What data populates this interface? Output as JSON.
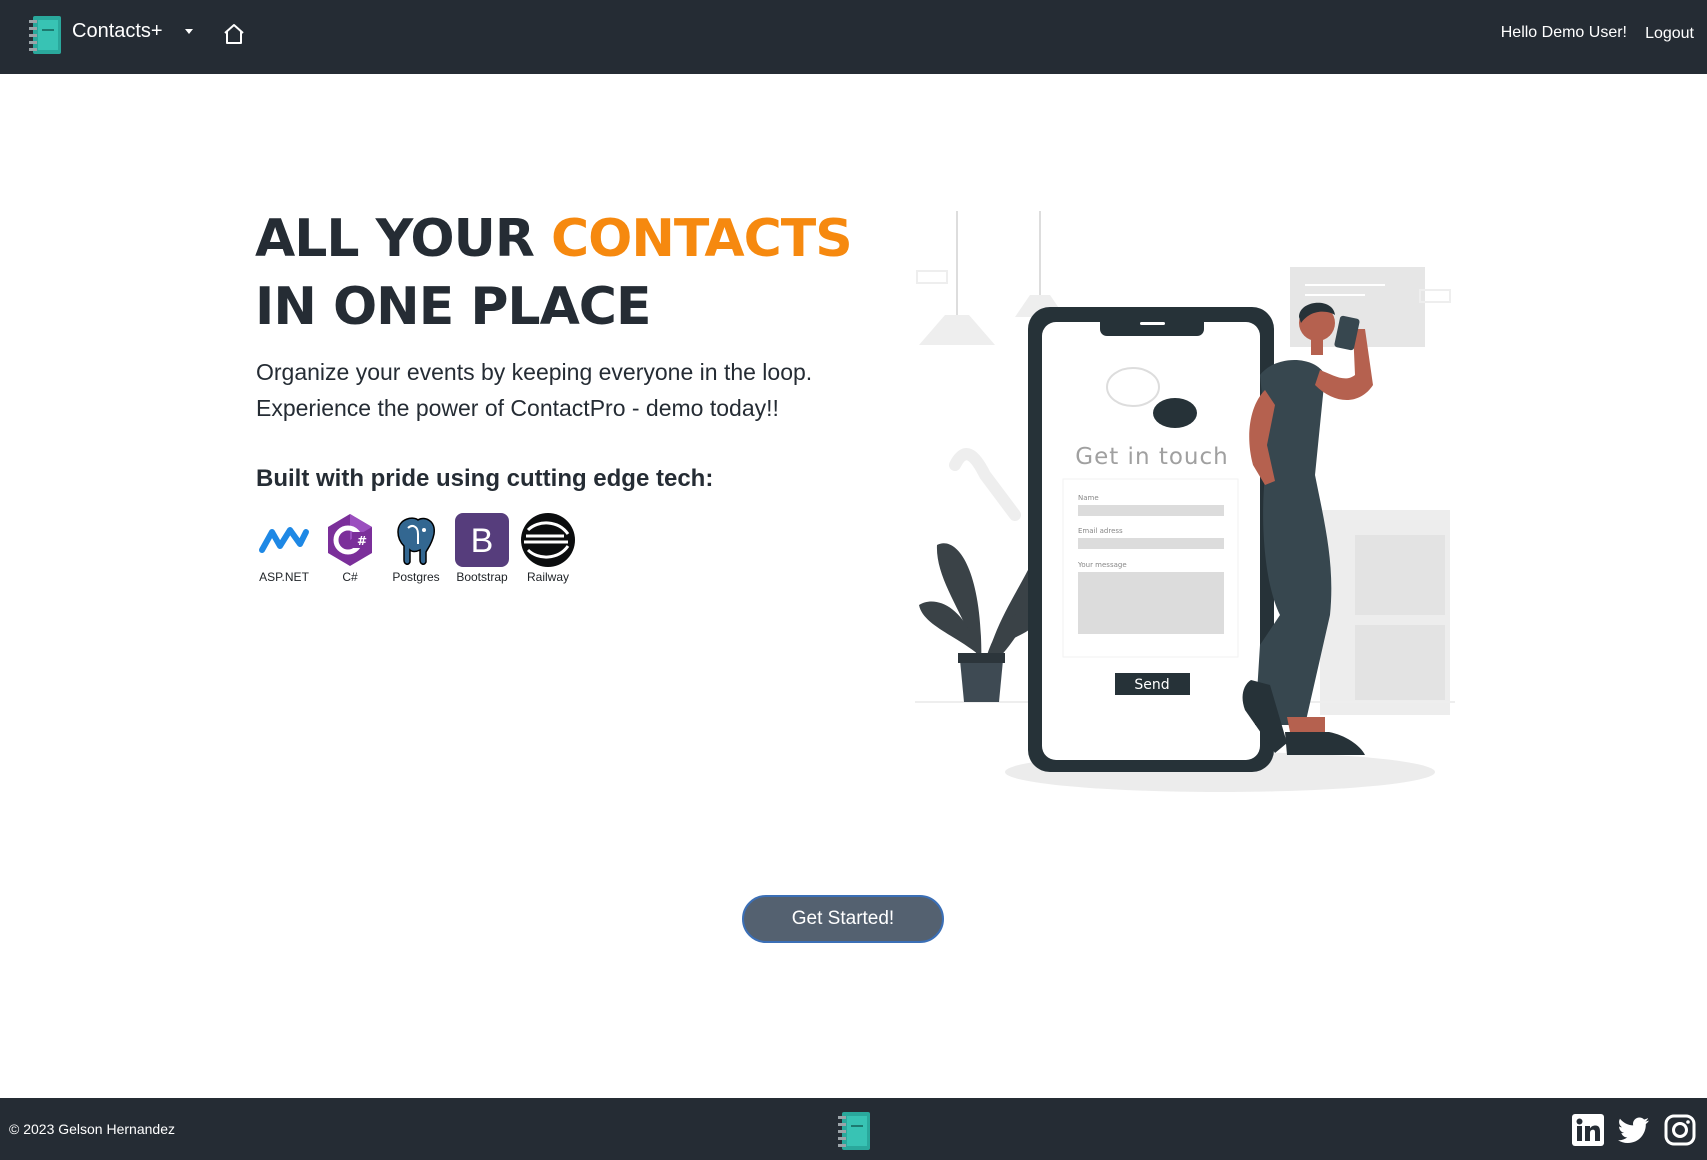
{
  "navbar": {
    "brand": "Contacts+",
    "greeting": "Hello Demo User!",
    "logout": "Logout"
  },
  "hero": {
    "title_part1": "ALL YOUR ",
    "title_accent": "CONTACTS",
    "title_part2": " IN ONE PLACE",
    "subtitle_line1": "Organize your events by keeping everyone in the loop.",
    "subtitle_line2": "Experience the power of ContactPro - demo today!!",
    "tech_heading": "Built with pride using cutting edge tech:",
    "tech": [
      {
        "label": "ASP.NET",
        "icon": "aspnet-icon"
      },
      {
        "label": "C#",
        "icon": "csharp-icon"
      },
      {
        "label": "Postgres",
        "icon": "postgres-icon"
      },
      {
        "label": "Bootstrap",
        "icon": "bootstrap-icon"
      },
      {
        "label": "Railway",
        "icon": "railway-icon"
      }
    ]
  },
  "illustration": {
    "heading": "Get in touch",
    "field_name": "Name",
    "field_email": "Email adress",
    "field_message": "Your message",
    "send": "Send"
  },
  "cta": {
    "label": "Get Started!"
  },
  "footer": {
    "copyright": "© 2023 Gelson Hernandez",
    "social": [
      "linkedin-icon",
      "twitter-icon",
      "instagram-icon"
    ]
  },
  "colors": {
    "navbar_bg": "#252c34",
    "accent": "#f6890f",
    "button_bg": "#546170",
    "button_border": "#3b6fb6"
  }
}
